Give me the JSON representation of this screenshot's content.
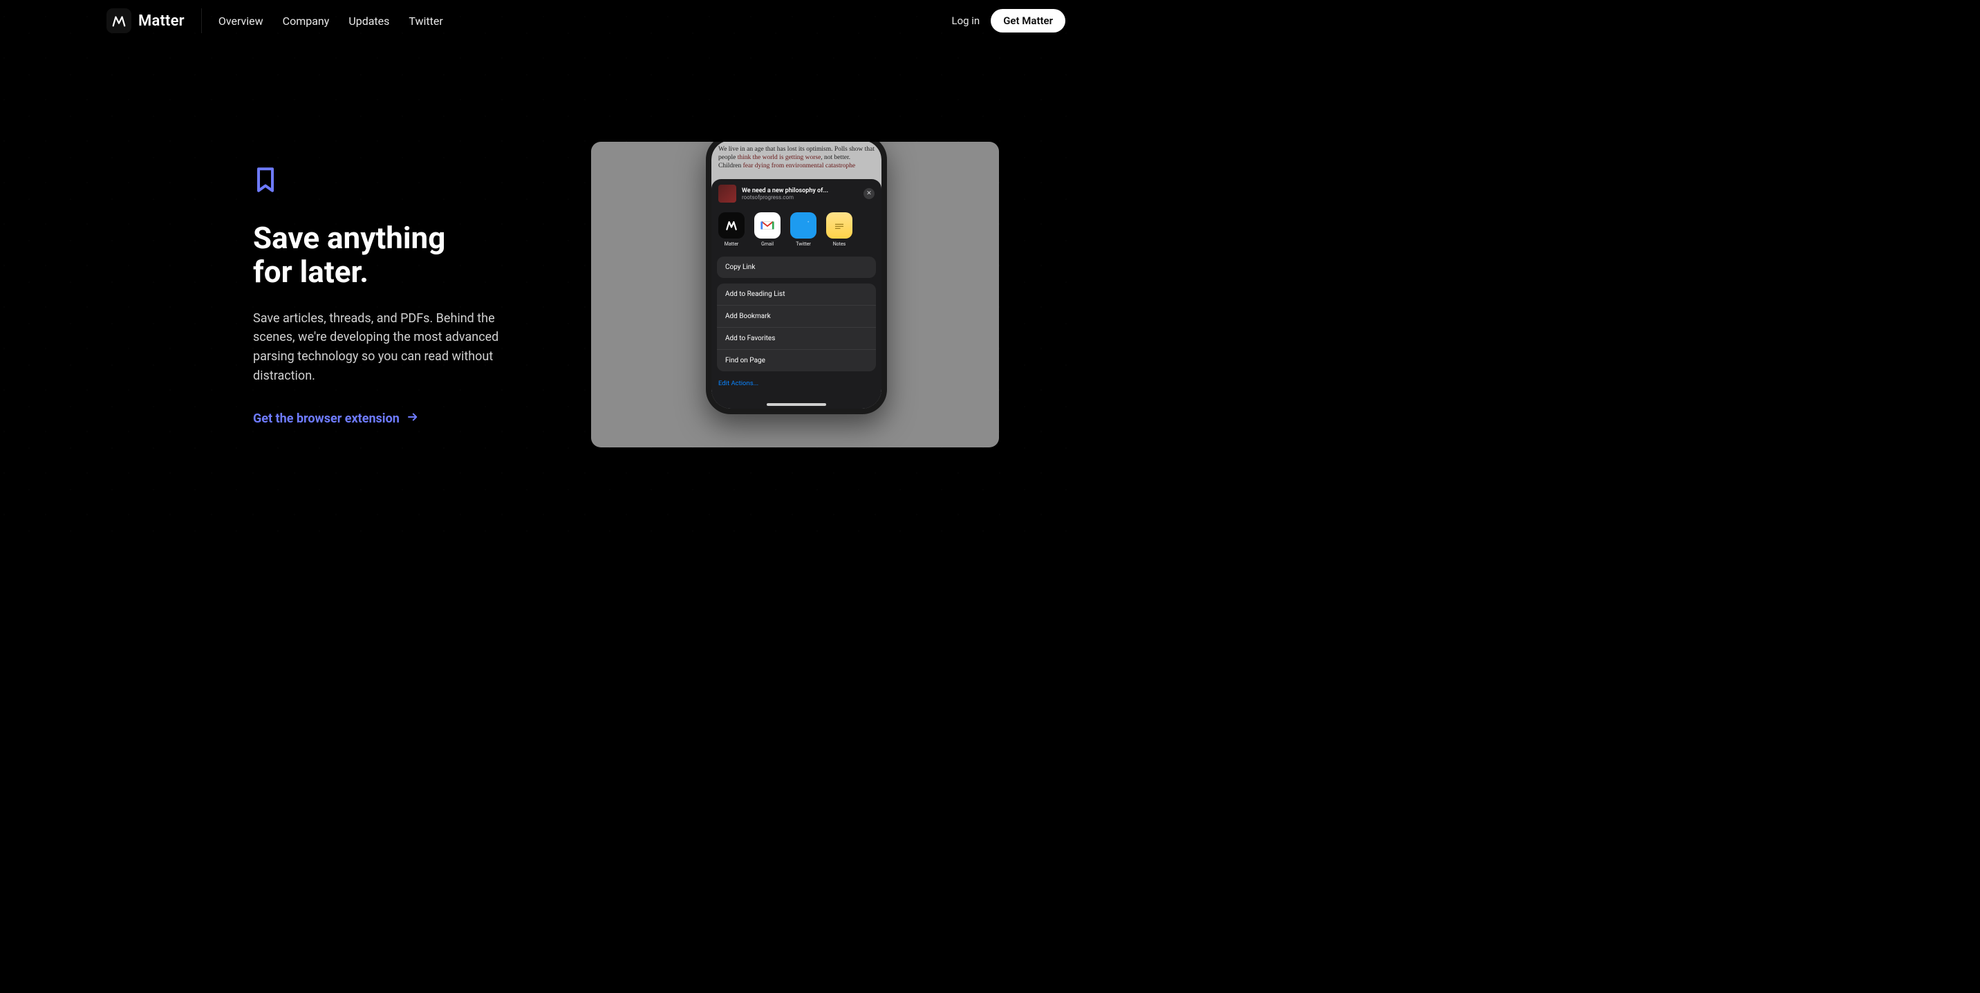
{
  "brand": {
    "name": "Matter"
  },
  "nav": {
    "items": [
      "Overview",
      "Company",
      "Updates",
      "Twitter"
    ],
    "login": "Log in",
    "cta": "Get Matter"
  },
  "hero": {
    "headline_l1": "Save anything",
    "headline_l2": "for later.",
    "body": "Save articles, threads, and PDFs. Behind the scenes, we're developing the most advanced parsing technology so you can read without distraction.",
    "link": "Get the browser extension"
  },
  "article": {
    "line_pre": "We live in an age that has lost its optimism. Polls show that people ",
    "line_red1": "think the world is getting worse",
    "line_mid": ", not better. Children ",
    "line_red2": "fear dying from environmental catastrophe"
  },
  "share": {
    "title": "We need a new philosophy of...",
    "source": "rootsofprogress.com",
    "apps": [
      {
        "id": "matter",
        "label": "Matter"
      },
      {
        "id": "gmail",
        "label": "Gmail"
      },
      {
        "id": "twitter",
        "label": "Twitter"
      },
      {
        "id": "notes",
        "label": "Notes"
      }
    ],
    "group1": [
      "Copy Link"
    ],
    "group2": [
      "Add to Reading List",
      "Add Bookmark",
      "Add to Favorites",
      "Find on Page"
    ],
    "edit": "Edit Actions..."
  }
}
